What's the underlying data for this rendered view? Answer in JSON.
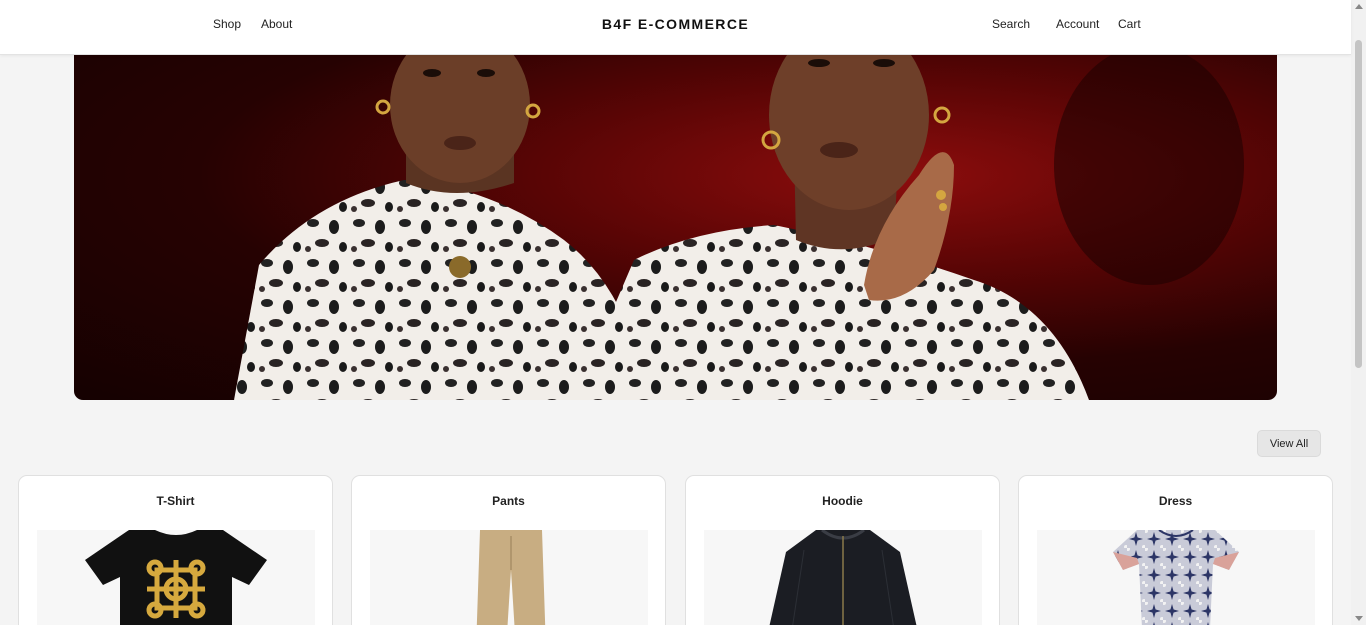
{
  "header": {
    "brand": "B4F E-COMMERCE",
    "nav_left": [
      "Shop",
      "About"
    ],
    "nav_right": [
      "Search",
      "Account",
      "Cart"
    ]
  },
  "hero": {
    "image": "leopard-print-models-photo"
  },
  "products": {
    "view_all_label": "View All",
    "items": [
      {
        "title": "T-Shirt",
        "image": "black-tshirt-gold-emblem"
      },
      {
        "title": "Pants",
        "image": "beige-pants"
      },
      {
        "title": "Hoodie",
        "image": "black-bomber-jacket"
      },
      {
        "title": "Dress",
        "image": "patterned-dress"
      }
    ]
  },
  "colors": {
    "accent": "#111111",
    "hero_bg": "#5a0505",
    "page_bg": "#f4f4f4"
  }
}
